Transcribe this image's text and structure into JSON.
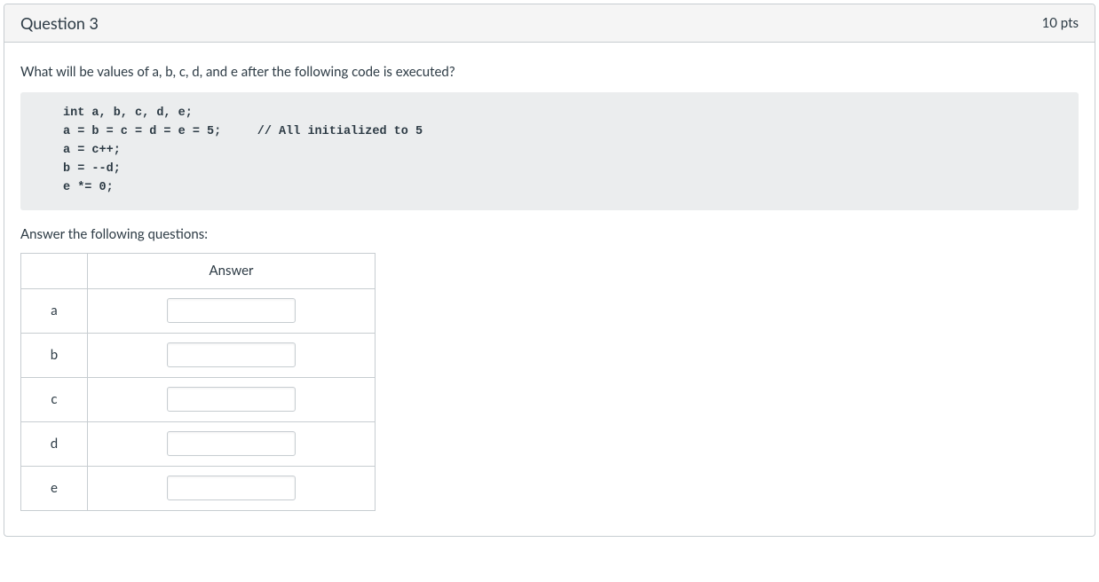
{
  "header": {
    "title": "Question 3",
    "points": "10 pts"
  },
  "prompt": "What will be values of a, b, c, d, and e after the following code is executed?",
  "code": "int a, b, c, d, e;\na = b = c = d = e = 5;     // All initialized to 5\na = c++;\nb = --d;\ne *= 0;",
  "subprompt": "Answer the following questions:",
  "table": {
    "header_blank": "",
    "header_answer": "Answer",
    "rows": [
      {
        "label": "a",
        "value": ""
      },
      {
        "label": "b",
        "value": ""
      },
      {
        "label": "c",
        "value": ""
      },
      {
        "label": "d",
        "value": ""
      },
      {
        "label": "e",
        "value": ""
      }
    ]
  }
}
